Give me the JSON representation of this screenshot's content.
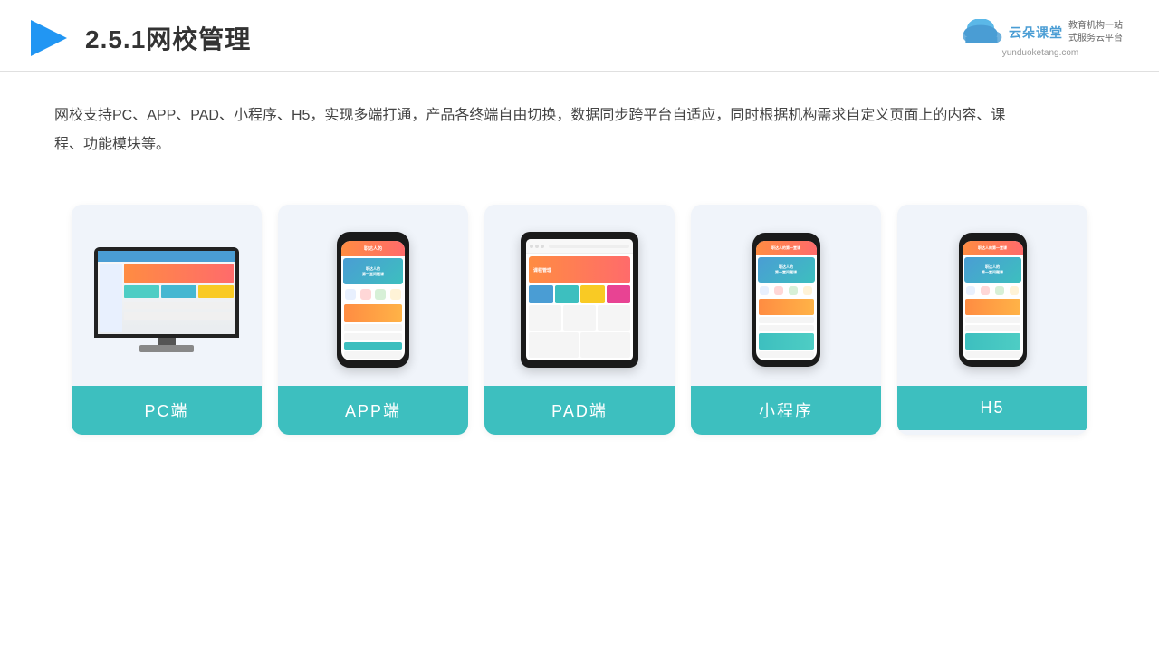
{
  "header": {
    "title": "2.5.1网校管理",
    "logo_text": "云朵课堂",
    "logo_url": "yunduoketang.com",
    "logo_tagline": "教育机构一站\n式服务云平台"
  },
  "description": {
    "text": "网校支持PC、APP、PAD、小程序、H5，实现多端打通，产品各终端自由切换，数据同步跨平台自适应，同时根据机构需求自定义页面上的内容、课程、功能模块等。"
  },
  "cards": [
    {
      "id": "pc",
      "label": "PC端"
    },
    {
      "id": "app",
      "label": "APP端"
    },
    {
      "id": "pad",
      "label": "PAD端"
    },
    {
      "id": "miniprogram",
      "label": "小程序"
    },
    {
      "id": "h5",
      "label": "H5"
    }
  ],
  "colors": {
    "accent": "#3dbfbf",
    "title_color": "#333333",
    "text_color": "#444444",
    "card_bg": "#f0f4fa"
  }
}
